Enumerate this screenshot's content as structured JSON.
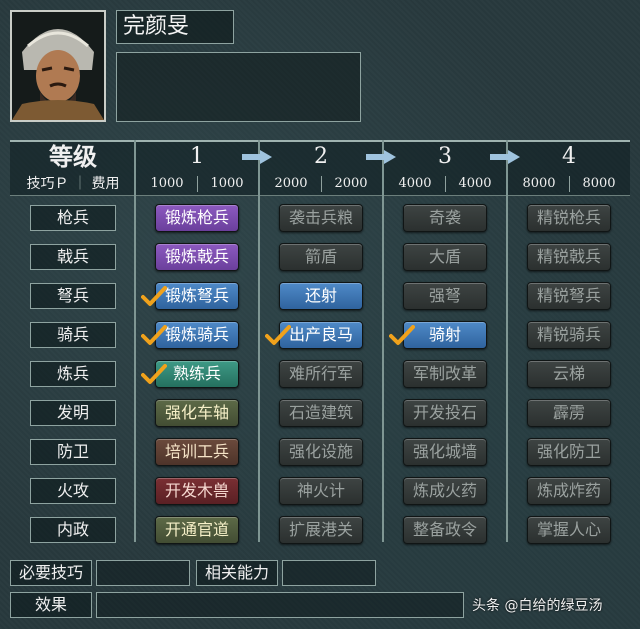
{
  "general": {
    "name": "完颜旻",
    "portrait_icon": "general-portrait"
  },
  "header": {
    "rank_title": "等级",
    "skill_p_label": "技巧Ｐ",
    "cost_label": "费用",
    "levels": [
      {
        "num": "1",
        "cost_a": "1000",
        "cost_b": "1000"
      },
      {
        "num": "2",
        "cost_a": "2000",
        "cost_b": "2000"
      },
      {
        "num": "3",
        "cost_a": "4000",
        "cost_b": "4000"
      },
      {
        "num": "4",
        "cost_a": "8000",
        "cost_b": "8000"
      }
    ]
  },
  "rows": [
    {
      "label": "枪兵",
      "skills": [
        {
          "text": "锻炼枪兵",
          "style": "purple",
          "learned": false
        },
        {
          "text": "袭击兵粮",
          "style": "gray",
          "learned": false
        },
        {
          "text": "奇袭",
          "style": "gray",
          "learned": false
        },
        {
          "text": "精锐枪兵",
          "style": "gray",
          "learned": false
        }
      ]
    },
    {
      "label": "戟兵",
      "skills": [
        {
          "text": "锻炼戟兵",
          "style": "purple",
          "learned": false
        },
        {
          "text": "箭盾",
          "style": "gray",
          "learned": false
        },
        {
          "text": "大盾",
          "style": "gray",
          "learned": false
        },
        {
          "text": "精锐戟兵",
          "style": "gray",
          "learned": false
        }
      ]
    },
    {
      "label": "弩兵",
      "skills": [
        {
          "text": "锻炼弩兵",
          "style": "blue",
          "learned": true
        },
        {
          "text": "还射",
          "style": "blue",
          "learned": false
        },
        {
          "text": "强弩",
          "style": "gray",
          "learned": false
        },
        {
          "text": "精锐弩兵",
          "style": "gray",
          "learned": false
        }
      ]
    },
    {
      "label": "骑兵",
      "skills": [
        {
          "text": "锻炼骑兵",
          "style": "blue",
          "learned": true
        },
        {
          "text": "出产良马",
          "style": "blue",
          "learned": true
        },
        {
          "text": "骑射",
          "style": "blue",
          "learned": true
        },
        {
          "text": "精锐骑兵",
          "style": "gray",
          "learned": false
        }
      ]
    },
    {
      "label": "炼兵",
      "skills": [
        {
          "text": "熟练兵",
          "style": "teal",
          "learned": true
        },
        {
          "text": "难所行军",
          "style": "gray",
          "learned": false
        },
        {
          "text": "军制改革",
          "style": "gray",
          "learned": false
        },
        {
          "text": "云梯",
          "style": "gray",
          "learned": false
        }
      ]
    },
    {
      "label": "发明",
      "skills": [
        {
          "text": "强化车轴",
          "style": "olive",
          "learned": false
        },
        {
          "text": "石造建筑",
          "style": "gray",
          "learned": false
        },
        {
          "text": "开发投石",
          "style": "gray",
          "learned": false
        },
        {
          "text": "霹雳",
          "style": "gray",
          "learned": false
        }
      ]
    },
    {
      "label": "防卫",
      "skills": [
        {
          "text": "培训工兵",
          "style": "brown",
          "learned": false
        },
        {
          "text": "强化设施",
          "style": "gray",
          "learned": false
        },
        {
          "text": "强化城墙",
          "style": "gray",
          "learned": false
        },
        {
          "text": "强化防卫",
          "style": "gray",
          "learned": false
        }
      ]
    },
    {
      "label": "火攻",
      "skills": [
        {
          "text": "开发木兽",
          "style": "red",
          "learned": false
        },
        {
          "text": "神火计",
          "style": "gray",
          "learned": false
        },
        {
          "text": "炼成火药",
          "style": "gray",
          "learned": false
        },
        {
          "text": "炼成炸药",
          "style": "gray",
          "learned": false
        }
      ]
    },
    {
      "label": "内政",
      "skills": [
        {
          "text": "开通官道",
          "style": "olive",
          "learned": false
        },
        {
          "text": "扩展港关",
          "style": "gray",
          "learned": false
        },
        {
          "text": "整备政令",
          "style": "gray",
          "learned": false
        },
        {
          "text": "掌握人心",
          "style": "gray",
          "learned": false
        }
      ]
    }
  ],
  "bottom": {
    "required_skill_label": "必要技巧",
    "related_ability_label": "相关能力",
    "effect_label": "效果",
    "required_skill_value": "",
    "related_ability_value": "",
    "effect_value": ""
  },
  "watermark": "头条 @白给的绿豆汤",
  "colors": {
    "accent_check": "#f0a21c",
    "arrow": "#9fc3de"
  }
}
